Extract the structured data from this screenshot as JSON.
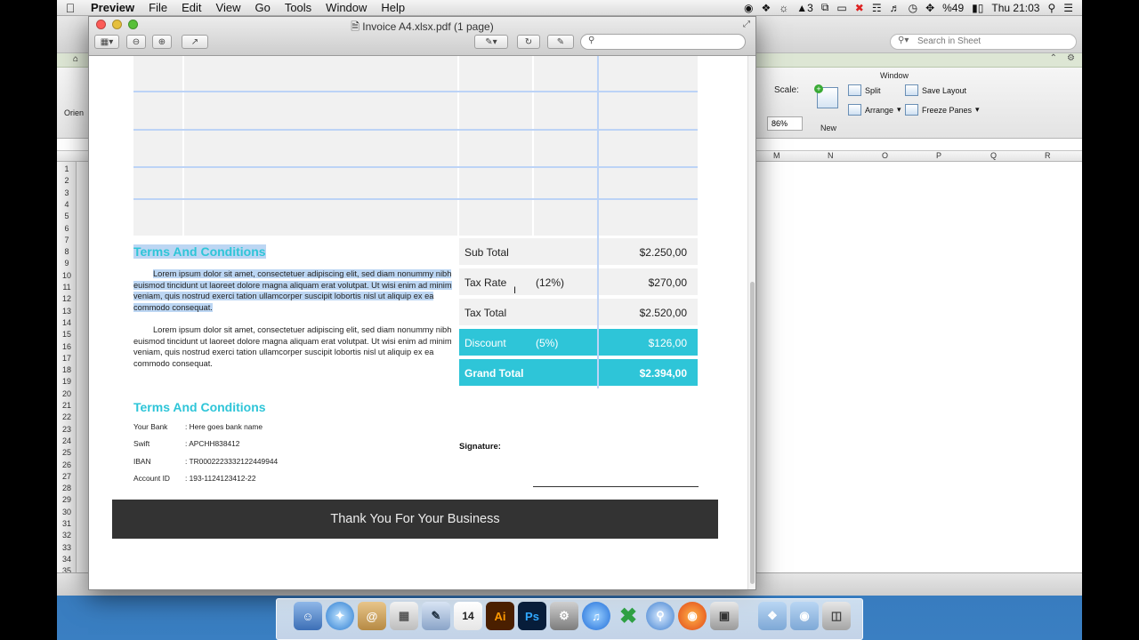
{
  "menubar": {
    "app_name": "Preview",
    "items": [
      "File",
      "Edit",
      "View",
      "Go",
      "Tools",
      "Window",
      "Help"
    ],
    "status_items": [
      "3",
      "%49",
      "Thu 21:03"
    ]
  },
  "excel": {
    "search_placeholder": "Search in Sheet",
    "ribbon": {
      "group_window": "Window",
      "scale_label": "Scale:",
      "scale_value": "86%",
      "new_label": "New",
      "split_label": "Split",
      "arrange_label": "Arrange",
      "save_layout_label": "Save Layout",
      "freeze_panes_label": "Freeze Panes",
      "orientation_label": "Orien"
    },
    "columns": [
      "M",
      "N",
      "O",
      "P",
      "Q",
      "R"
    ],
    "rows": [
      "1",
      "2",
      "3",
      "4",
      "5",
      "6",
      "7",
      "8",
      "9",
      "10",
      "11",
      "12",
      "13",
      "14",
      "15",
      "16",
      "17",
      "18",
      "19",
      "20",
      "21",
      "22",
      "23",
      "24",
      "25",
      "26",
      "27",
      "28",
      "29",
      "30",
      "31",
      "32",
      "33",
      "34",
      "35"
    ]
  },
  "preview": {
    "title": "Invoice A4.xlsx.pdf (1 page)"
  },
  "invoice": {
    "totals": [
      {
        "label": "Sub Total",
        "rate": "",
        "value": "$2.250,00",
        "highlight": false,
        "bold": false
      },
      {
        "label": "Tax Rate",
        "rate": "(12%)",
        "value": "$270,00",
        "highlight": false,
        "bold": false
      },
      {
        "label": "Tax Total",
        "rate": "",
        "value": "$2.520,00",
        "highlight": false,
        "bold": false
      },
      {
        "label": "Discount",
        "rate": "(5%)",
        "value": "$126,00",
        "highlight": true,
        "bold": false
      },
      {
        "label": "Grand Total",
        "rate": "",
        "value": "$2.394,00",
        "highlight": true,
        "bold": true
      }
    ],
    "terms_heading_1": "Terms And Conditions",
    "terms_para_1": "Lorem ipsum dolor sit amet, consectetuer adipiscing elit, sed diam nonummy nibh euismod tincidunt ut laoreet dolore magna aliquam erat volutpat. Ut wisi enim ad minim veniam, quis nostrud exerci tation ullamcorper suscipit lobortis nisl ut aliquip ex ea commodo consequat.",
    "terms_para_2": "Lorem ipsum dolor sit amet, consectetuer adipiscing elit, sed diam nonummy nibh euismod tincidunt ut laoreet dolore magna aliquam erat volutpat. Ut wisi enim ad minim veniam, quis nostrud exerci tation ullamcorper suscipit lobortis nisl ut aliquip ex ea commodo consequat.",
    "terms_heading_2": "Terms And Conditions",
    "bank_details": [
      {
        "key": "Your Bank",
        "value": ": Here goes bank name"
      },
      {
        "key": "Swift",
        "value": ": APCHH838412"
      },
      {
        "key": "IBAN",
        "value": ": TR0002223332122449944"
      },
      {
        "key": "Account ID",
        "value": ": 193-1124123412-22"
      }
    ],
    "signature_label": "Signature:",
    "footer_text": "Thank You For Your  Business"
  },
  "dock": {
    "calendar_day": "14",
    "illustrator_label": "Ai",
    "photoshop_label": "Ps"
  },
  "colors": {
    "accent": "#2ec5d8",
    "footer_bg": "#333333",
    "grid_blue": "#bcd3f6",
    "selection": "#bcd6f3"
  }
}
